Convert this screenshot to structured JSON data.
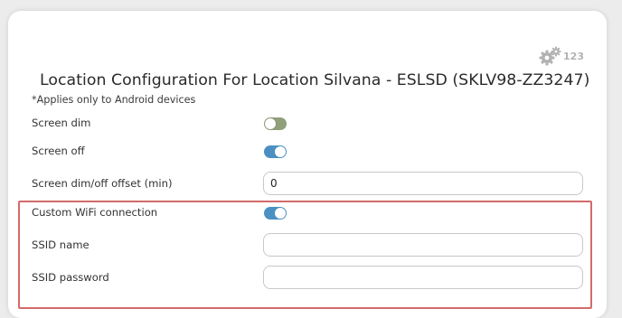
{
  "colors": {
    "toggle_on": "#4a90c2",
    "toggle_off": "#8fa07a",
    "highlight_border": "#d46a6a"
  },
  "header": {
    "settings_icon": "gears-icon",
    "settings_count": "123",
    "title": "Location Configuration For Location Silvana - ESLSD (SKLV98-ZZ3247)"
  },
  "note": "*Applies only to Android devices",
  "rows": {
    "screen_dim": {
      "label": "Screen dim",
      "enabled": false
    },
    "screen_off": {
      "label": "Screen off",
      "enabled": true
    },
    "offset": {
      "label": "Screen dim/off offset (min)",
      "value": "0",
      "placeholder": ""
    },
    "custom_wifi": {
      "label": "Custom WiFi connection",
      "enabled": true
    },
    "ssid_name": {
      "label": "SSID name",
      "value": "",
      "placeholder": ""
    },
    "ssid_password": {
      "label": "SSID password",
      "value": "",
      "placeholder": ""
    }
  }
}
